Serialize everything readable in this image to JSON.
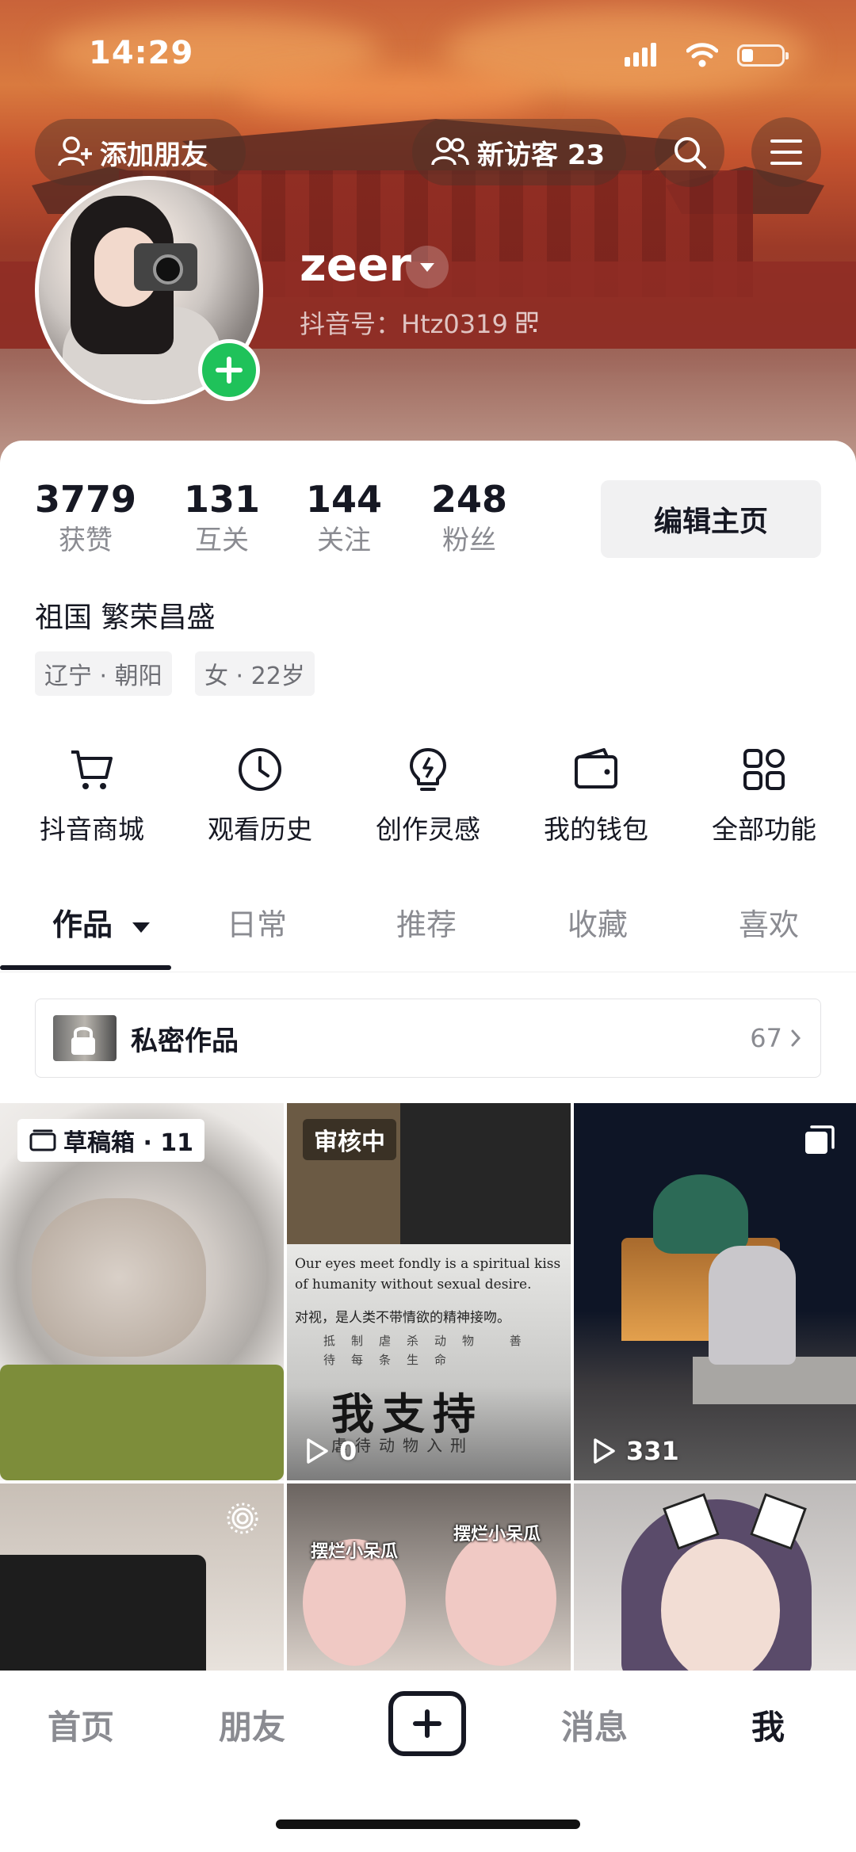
{
  "status_bar": {
    "time": "14:29"
  },
  "header": {
    "add_friend": "添加朋友",
    "new_visitors": "新访客 23",
    "username": "zeer",
    "douyin_id": "抖音号：Htz0319"
  },
  "stats": [
    {
      "num": "3779",
      "label": "获赞"
    },
    {
      "num": "131",
      "label": "互关"
    },
    {
      "num": "144",
      "label": "关注"
    },
    {
      "num": "248",
      "label": "粉丝"
    }
  ],
  "edit_profile": "编辑主页",
  "bio": "祖国 繁荣昌盛",
  "tags": [
    "辽宁 · 朝阳",
    "女 · 22岁"
  ],
  "functions": [
    {
      "icon": "cart-icon",
      "label": "抖音商城"
    },
    {
      "icon": "clock-icon",
      "label": "观看历史"
    },
    {
      "icon": "bulb-icon",
      "label": "创作灵感"
    },
    {
      "icon": "wallet-icon",
      "label": "我的钱包"
    },
    {
      "icon": "grid-icon",
      "label": "全部功能"
    }
  ],
  "tabs": [
    "作品",
    "日常",
    "推荐",
    "收藏",
    "喜欢"
  ],
  "private": {
    "label": "私密作品",
    "count": "67"
  },
  "grid": {
    "drafts": "草稿箱 · 11",
    "review": "审核中",
    "v2_plays": "0",
    "v3_plays": "331",
    "post_en": "Our eyes meet fondly is a spiritual kiss of humanity without sexual desire.",
    "post_cn": "对视，是人类不带情欲的精神接吻。",
    "post_small": "抵制虐杀动物 善待每条生命",
    "post_big": "我支持",
    "post_sub": "虐待动物入刑",
    "sticker_1": "摆烂小呆瓜",
    "sticker_2": "摆烂小呆瓜"
  },
  "bottom_nav": [
    "首页",
    "朋友",
    "消息",
    "我"
  ],
  "colors": {
    "accent_green": "#1fc25a",
    "text_primary": "#161823",
    "text_secondary": "#8a8b91"
  }
}
